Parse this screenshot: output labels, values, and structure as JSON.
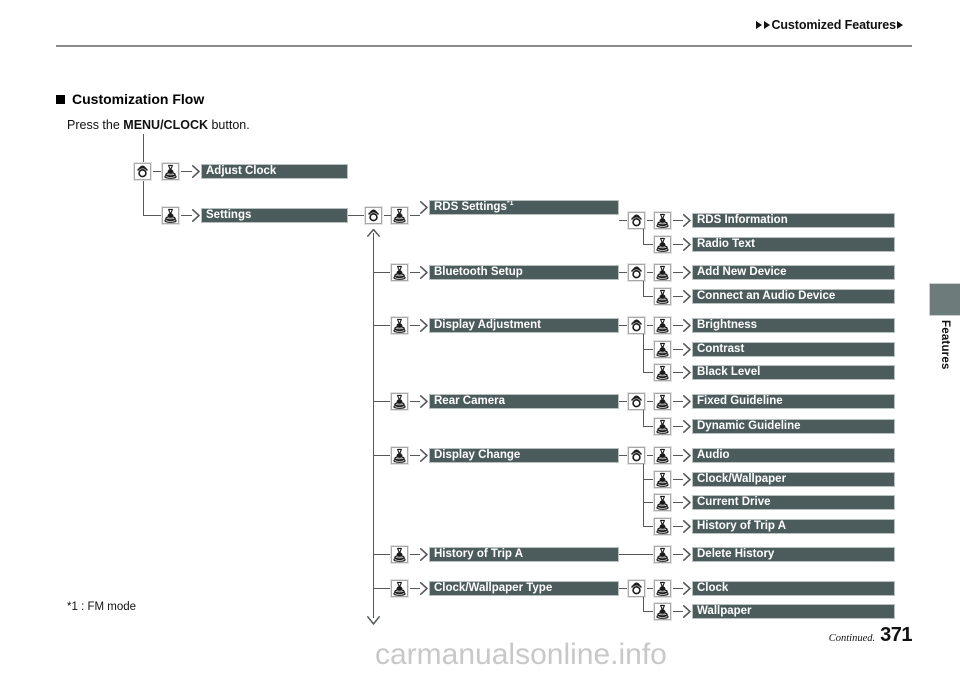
{
  "header": {
    "breadcrumb": "Customized Features",
    "left_marker_icon": "triangle-right-icon",
    "right_marker_icon": "triangle-right-icon"
  },
  "section": {
    "title": "Customization Flow",
    "bullet_icon": "square-bullet-icon",
    "instruction_prefix": "Press the ",
    "instruction_button": "MENU/CLOCK",
    "instruction_suffix": " button."
  },
  "side_tab": {
    "label": "Features",
    "color": "#6d7b7b"
  },
  "footnote": "*1 : FM mode",
  "footer": {
    "continued": "Continued.",
    "page": "371",
    "watermark": "carmanualsonline.info"
  },
  "icons": {
    "rotate": "rotate-knob-icon",
    "press": "press-knob-icon"
  },
  "colors": {
    "bar_fill": "#4c5b5c",
    "bar_text": "#ffffff",
    "line": "#55595a",
    "accent": "#6d7b7b"
  },
  "flow": {
    "level1": [
      {
        "label": "Adjust Clock",
        "icons": [
          "rotate",
          "press"
        ]
      },
      {
        "label": "Settings",
        "icons": [
          "press"
        ]
      }
    ],
    "level2": [
      {
        "label": "RDS Settings",
        "sup": "*1",
        "icons": [
          "rotate",
          "press"
        ]
      },
      {
        "label": "Bluetooth Setup",
        "icons": [
          "press"
        ]
      },
      {
        "label": "Display Adjustment",
        "icons": [
          "press"
        ]
      },
      {
        "label": "Rear Camera",
        "icons": [
          "press"
        ]
      },
      {
        "label": "Display Change",
        "icons": [
          "press"
        ]
      },
      {
        "label": "History of Trip A",
        "icons": [
          "press"
        ]
      },
      {
        "label": "Clock/Wallpaper Type",
        "icons": [
          "press"
        ]
      }
    ],
    "level3": [
      {
        "label": "RDS Information",
        "parent": "RDS Settings",
        "icons": [
          "rotate",
          "press"
        ]
      },
      {
        "label": "Radio Text",
        "parent": "RDS Settings",
        "icons": [
          "press"
        ]
      },
      {
        "label": "Add New Device",
        "parent": "Bluetooth Setup",
        "icons": [
          "rotate",
          "press"
        ]
      },
      {
        "label": "Connect an Audio Device",
        "parent": "Bluetooth Setup",
        "icons": [
          "press"
        ]
      },
      {
        "label": "Brightness",
        "parent": "Display Adjustment",
        "icons": [
          "rotate",
          "press"
        ]
      },
      {
        "label": "Contrast",
        "parent": "Display Adjustment",
        "icons": [
          "press"
        ]
      },
      {
        "label": "Black Level",
        "parent": "Display Adjustment",
        "icons": [
          "press"
        ]
      },
      {
        "label": "Fixed Guideline",
        "parent": "Rear Camera",
        "icons": [
          "rotate",
          "press"
        ]
      },
      {
        "label": "Dynamic Guideline",
        "parent": "Rear Camera",
        "icons": [
          "press"
        ]
      },
      {
        "label": "Audio",
        "parent": "Display Change",
        "icons": [
          "rotate",
          "press"
        ]
      },
      {
        "label": "Clock/Wallpaper",
        "parent": "Display Change",
        "icons": [
          "press"
        ]
      },
      {
        "label": "Current Drive",
        "parent": "Display Change",
        "icons": [
          "press"
        ]
      },
      {
        "label": "History of Trip A",
        "parent": "Display Change",
        "icons": [
          "press"
        ]
      },
      {
        "label": "Delete History",
        "parent": "History of Trip A",
        "icons": [
          "press"
        ]
      },
      {
        "label": "Clock",
        "parent": "Clock/Wallpaper Type",
        "icons": [
          "rotate",
          "press"
        ]
      },
      {
        "label": "Wallpaper",
        "parent": "Clock/Wallpaper Type",
        "icons": [
          "press"
        ]
      }
    ]
  }
}
